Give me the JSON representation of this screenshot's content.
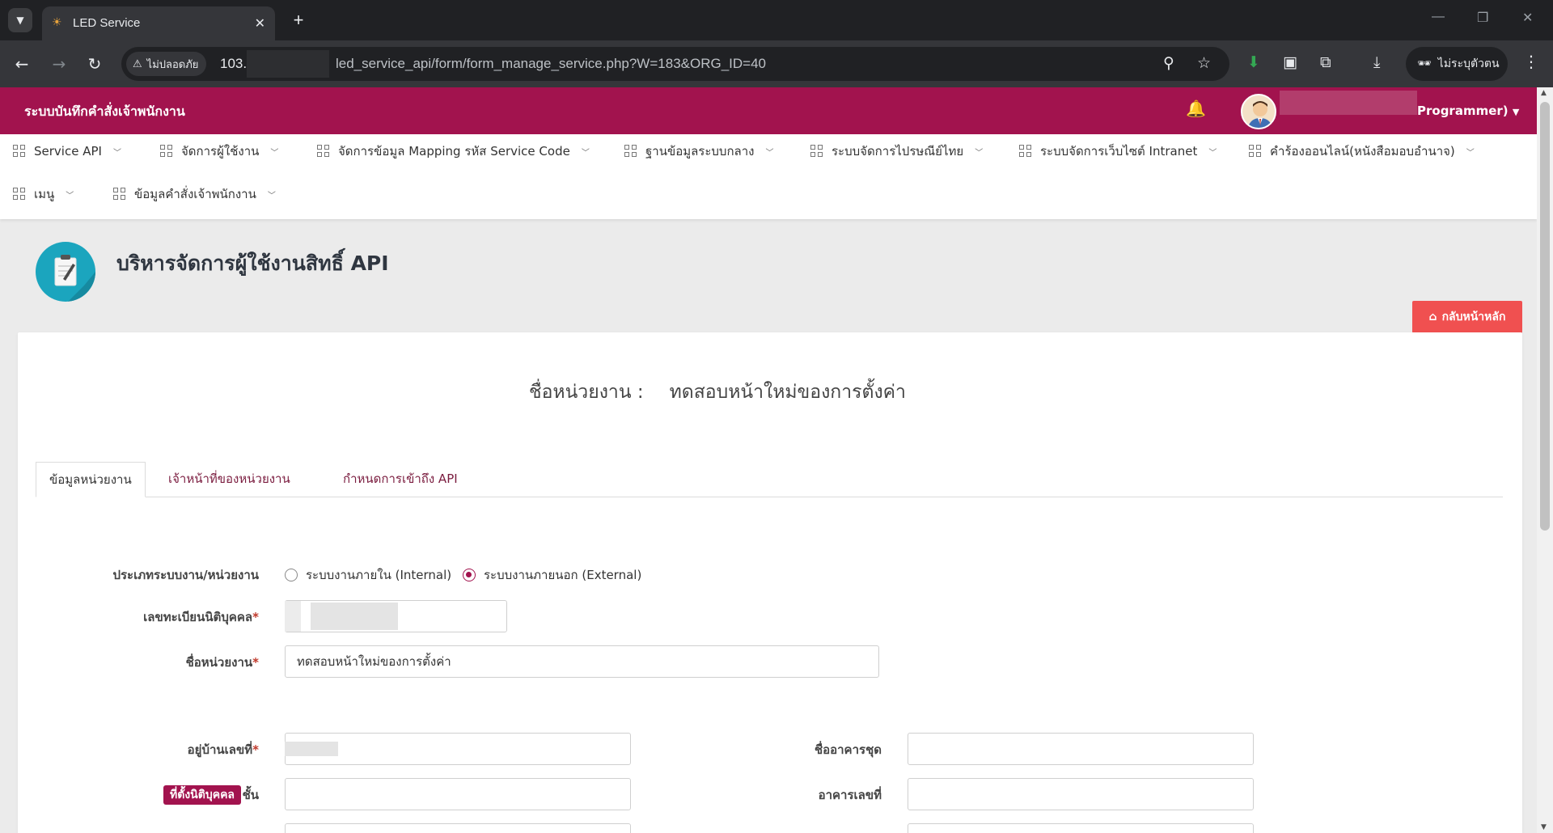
{
  "browser": {
    "tab_title": "LED Service",
    "tab_close": "✕",
    "new_tab": "+",
    "security_label": "ไม่ปลอดภัย",
    "url_host": "103.",
    "url_path": "led_service_api/form/form_manage_service.php?W=183&ORG_ID=40",
    "profile_label": "ไม่ระบุตัวตน"
  },
  "app": {
    "title": "ระบบบันทึกคำสั่งเจ้าพนักงาน",
    "user_role": "Programmer)"
  },
  "menu": {
    "row1": [
      {
        "label": "Service API"
      },
      {
        "label": "จัดการผู้ใช้งาน"
      },
      {
        "label": "จัดการข้อมูล Mapping รหัส Service Code"
      },
      {
        "label": "ฐานข้อมูลระบบกลาง"
      },
      {
        "label": "ระบบจัดการไปรษณีย์ไทย"
      },
      {
        "label": "ระบบจัดการเว็บไซต์ Intranet"
      },
      {
        "label": "คำร้องออนไลน์(หนังสือมอบอำนาจ)"
      }
    ],
    "row2": [
      {
        "label": "เมนู"
      },
      {
        "label": "ข้อมูลคำสั่งเจ้าพนักงาน"
      }
    ]
  },
  "page": {
    "title": "บริหารจัดการผู้ใช้งานสิทธิ์ API",
    "home_button": "กลับหน้าหลัก"
  },
  "org": {
    "label": "ชื่อหน่วยงาน :",
    "value": "ทดสอบหน้าใหม่ของการตั้งค่า"
  },
  "tabs": [
    {
      "label": "ข้อมูลหน่วยงาน"
    },
    {
      "label": "เจ้าหน้าที่ของหน่วยงาน"
    },
    {
      "label": "กำหนดการเข้าถึง API"
    }
  ],
  "form": {
    "system_type_label": "ประเภทระบบงาน/หน่วยงาน",
    "option_internal": "ระบบงานภายใน (Internal)",
    "option_external": "ระบบงานภายนอก (External)",
    "selected_option": "external",
    "juristic_id_label": "เลขทะเบียนนิติบุคคล",
    "org_name_label": "ชื่อหน่วยงาน",
    "org_name_value": "ทดสอบหน้าใหม่ของการตั้งค่า",
    "required_mark": "*",
    "address_section": "ที่ตั้งนิติบุคคล",
    "house_no_label": "อยู่บ้านเลขที่",
    "building_label": "ชื่ออาคารชุด",
    "floor_label": "ชั้น",
    "building_no_label": "อาคารเลขที่"
  },
  "colors": {
    "brand": "#a2134e",
    "home_button": "#f05050",
    "page_icon": "#1ba5be"
  }
}
